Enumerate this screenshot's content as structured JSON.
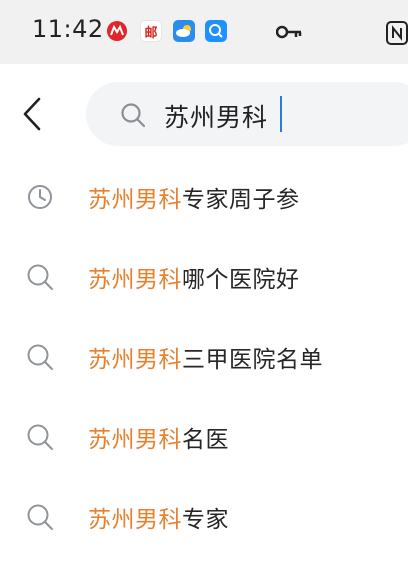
{
  "status_bar": {
    "time": "11:42",
    "app_icons": [
      {
        "name": "cmb-bank-icon",
        "glyph": "M",
        "color": "#e0262b"
      },
      {
        "name": "post-icon",
        "glyph": "邮",
        "color": "#d7261d"
      },
      {
        "name": "weather-icon",
        "glyph": "☁",
        "color": "#2b8cf0"
      },
      {
        "name": "search-app-icon",
        "glyph": "Q",
        "color": "#1e90ff"
      }
    ],
    "key_icon": "key-icon",
    "nfc_icon": "nfc-icon"
  },
  "search": {
    "query": "苏州男科",
    "back_icon": "chevron-left-icon"
  },
  "suggestions": [
    {
      "icon": "history-icon",
      "highlight": "苏州男科",
      "rest": "专家周子参"
    },
    {
      "icon": "search-icon",
      "highlight": "苏州男科",
      "rest": "哪个医院好"
    },
    {
      "icon": "search-icon",
      "highlight": "苏州男科",
      "rest": "三甲医院名单"
    },
    {
      "icon": "search-icon",
      "highlight": "苏州男科",
      "rest": "名医"
    },
    {
      "icon": "search-icon",
      "highlight": "苏州男科",
      "rest": "专家"
    }
  ],
  "colors": {
    "highlight": "#e8802e",
    "caret": "#2e78e6",
    "search_bg": "#f2f4f6"
  }
}
